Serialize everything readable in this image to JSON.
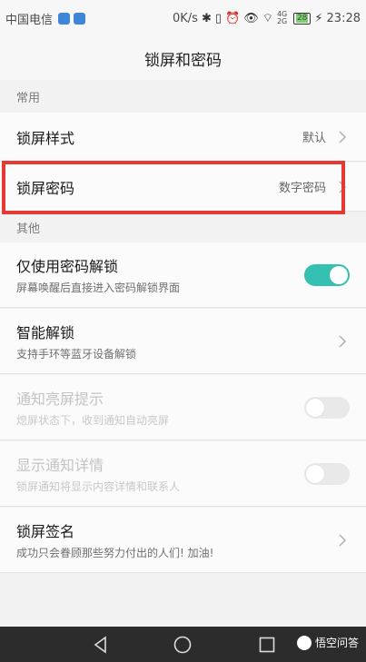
{
  "status_bar": {
    "carrier": "中国电信",
    "speed": "0K/s",
    "network": "4G 2G",
    "battery": "28",
    "time": "23:28"
  },
  "app_bar": {
    "title": "锁屏和密码"
  },
  "sections": {
    "common": "常用",
    "other": "其他"
  },
  "rows": {
    "lock_style": {
      "title": "锁屏样式",
      "value": "默认"
    },
    "lock_password": {
      "title": "锁屏密码",
      "value": "数字密码"
    },
    "password_unlock_only": {
      "title": "仅使用密码解锁",
      "sub": "屏幕唤醒后直接进入密码解锁界面",
      "enabled": true
    },
    "smart_unlock": {
      "title": "智能解锁",
      "sub": "支持手环等蓝牙设备解锁"
    },
    "notification_wake": {
      "title": "通知亮屏提示",
      "sub": "熄屏状态下，收到通知自动亮屏",
      "enabled": false
    },
    "show_notification_details": {
      "title": "显示通知详情",
      "sub": "锁屏通知将显示内容详情和联系人",
      "enabled": false
    },
    "lock_signature": {
      "title": "锁屏签名",
      "sub": "成功只会眷顾那些努力付出的人们! 加油!"
    }
  },
  "watermark": {
    "text": "悟空问答"
  },
  "colors": {
    "accent": "#35c1b2",
    "highlight": "#e53935"
  }
}
